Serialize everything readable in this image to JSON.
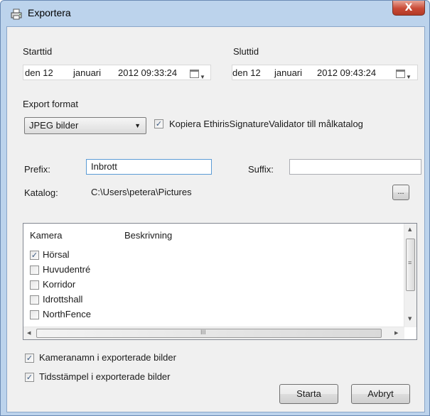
{
  "window": {
    "title": "Exportera",
    "close_glyph": "X"
  },
  "start": {
    "label": "Starttid",
    "day": "den 12",
    "month": "januari",
    "rest": "2012 09:33:24"
  },
  "end": {
    "label": "Sluttid",
    "day": "den 12",
    "month": "januari",
    "rest": "2012 09:43:24"
  },
  "format": {
    "label": "Export format",
    "selected": "JPEG bilder",
    "copy_label": "Kopiera EthirisSignatureValidator till målkatalog",
    "copy_checked": true
  },
  "prefix": {
    "label": "Prefix:",
    "value": "Inbrott"
  },
  "suffix": {
    "label": "Suffix:",
    "value": ""
  },
  "catalog": {
    "label": "Katalog:",
    "value": "C:\\Users\\petera\\Pictures",
    "browse": "..."
  },
  "cameras": {
    "columns": [
      "Kamera",
      "Beskrivning"
    ],
    "rows": [
      {
        "name": "Hörsal",
        "checked": true
      },
      {
        "name": "Huvudentré",
        "checked": false
      },
      {
        "name": "Korridor",
        "checked": false
      },
      {
        "name": "Idrottshall",
        "checked": false
      },
      {
        "name": "NorthFence",
        "checked": false
      }
    ],
    "hscroll_grip": "III",
    "vscroll_grip": "≡"
  },
  "options": {
    "camera_names": {
      "label": "Kameranamn i exporterade bilder",
      "checked": true
    },
    "timestamp": {
      "label": "Tidsstämpel i exporterade bilder",
      "checked": true
    }
  },
  "buttons": {
    "start": "Starta",
    "cancel": "Avbryt"
  },
  "colors": {
    "frame": "#bcd3ec",
    "client": "#f0f0f0",
    "close": "#c94a36",
    "focus": "#5b9bd5"
  }
}
